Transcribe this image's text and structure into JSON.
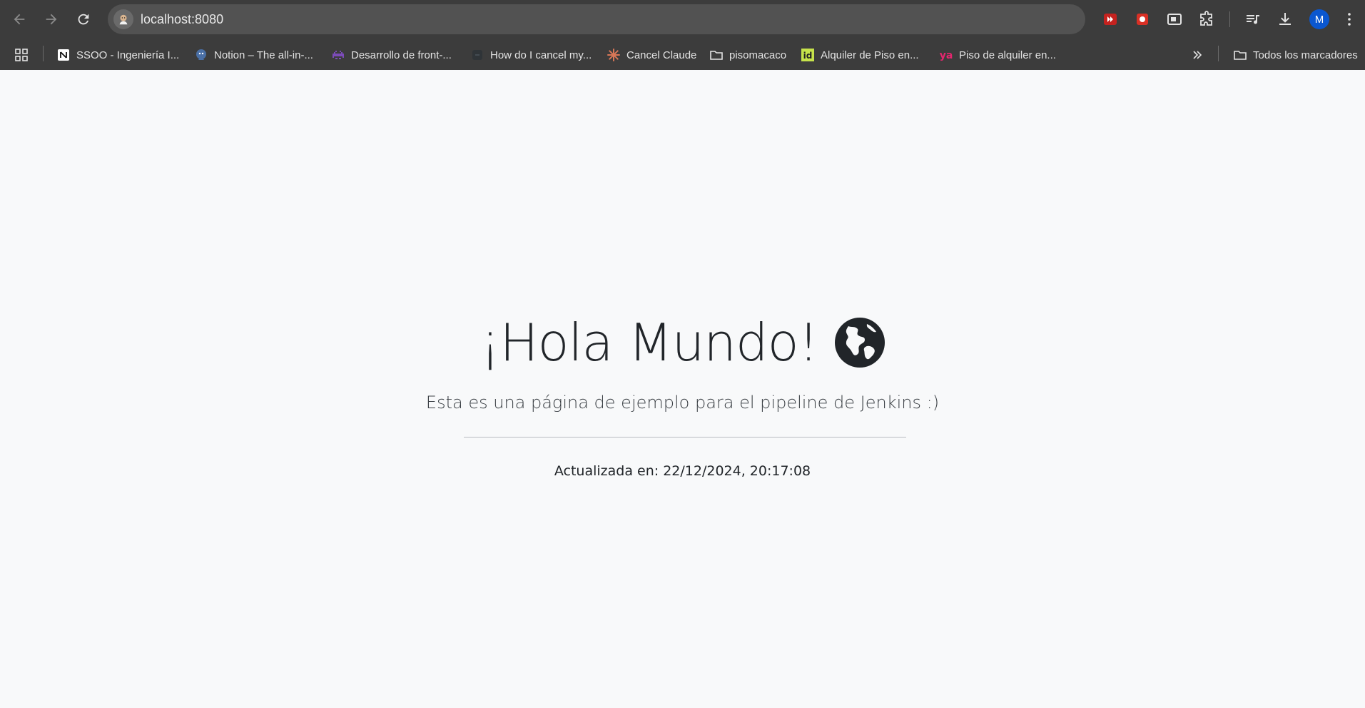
{
  "browser": {
    "url": "localhost:8080",
    "avatar_initial": "M",
    "bookmarks": [
      {
        "label": "SSOO - Ingeniería I...",
        "icon": "notion-icon"
      },
      {
        "label": "Notion – The all-in-...",
        "icon": "notion-ai-icon"
      },
      {
        "label": "Desarrollo de front-...",
        "icon": "space-invader-icon"
      },
      {
        "label": "How do I cancel my...",
        "icon": "site-icon"
      },
      {
        "label": "Cancel Claude",
        "icon": "claude-icon"
      },
      {
        "label": "pisomacaco",
        "icon": "folder-icon"
      },
      {
        "label": "Alquiler de Piso en...",
        "icon": "idealista-icon"
      },
      {
        "label": "Piso de alquiler en...",
        "icon": "yaencontre-icon"
      }
    ],
    "all_bookmarks_label": "Todos los marcadores"
  },
  "page": {
    "title": "¡Hola Mundo!",
    "title_icon": "globe-icon",
    "subtitle": "Esta es una página de ejemplo para el pipeline de Jenkins :)",
    "updated_text": "Actualizada en: 22/12/2024, 20:17:08"
  },
  "colors": {
    "chrome_bg": "#3c3c3c",
    "omnibox_bg": "#525252",
    "page_bg": "#f8f9fa",
    "text": "#212529",
    "avatar_bg": "#0b57d0"
  }
}
